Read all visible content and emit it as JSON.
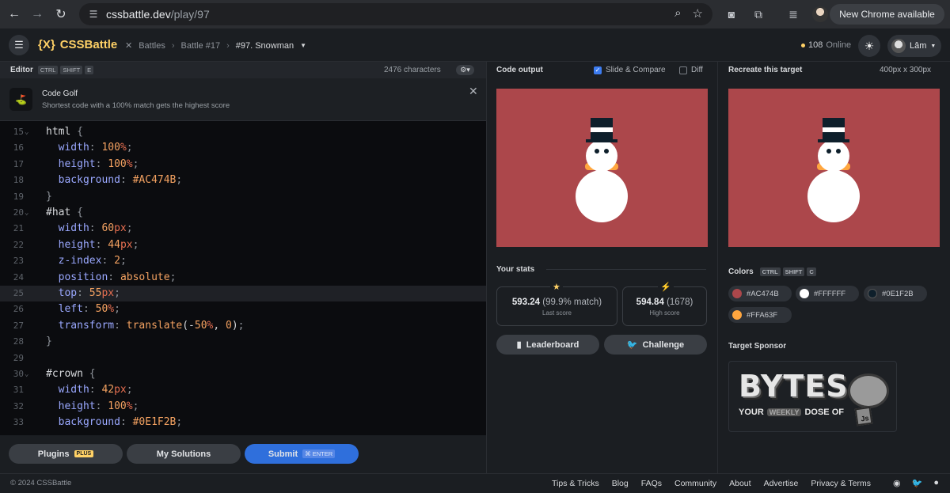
{
  "browser": {
    "url_host": "cssbattle.dev",
    "url_path": "/play/97",
    "new_chrome_label": "New Chrome available"
  },
  "header": {
    "logo": "{X}",
    "brand": "CSSBattle",
    "breadcrumbs": [
      "Battles",
      "Battle #17",
      "#97. Snowman"
    ],
    "online_count": "108",
    "online_label": "Online",
    "user_name": "Lâm"
  },
  "editor": {
    "label": "Editor",
    "shortcut": [
      "CTRL",
      "SHIFT",
      "E"
    ],
    "char_count": "2476 characters",
    "golf_title": "Code Golf",
    "golf_subtitle": "Shortest code with a 100% match gets the highest score",
    "lines": [
      {
        "n": "15",
        "fold": true,
        "code": "html {"
      },
      {
        "n": "16",
        "code": "  width: 100%;"
      },
      {
        "n": "17",
        "code": "  height: 100%;"
      },
      {
        "n": "18",
        "code": "  background: #AC474B;"
      },
      {
        "n": "19",
        "code": "}"
      },
      {
        "n": "20",
        "fold": true,
        "code": "#hat {"
      },
      {
        "n": "21",
        "code": "  width: 60px;"
      },
      {
        "n": "22",
        "code": "  height: 44px;"
      },
      {
        "n": "23",
        "code": "  z-index: 2;"
      },
      {
        "n": "24",
        "code": "  position: absolute;"
      },
      {
        "n": "25",
        "code": "  top: 55px;",
        "active": true
      },
      {
        "n": "26",
        "code": "  left: 50%;"
      },
      {
        "n": "27",
        "code": "  transform: translate(-50%, 0);"
      },
      {
        "n": "28",
        "code": "}"
      },
      {
        "n": "29",
        "code": ""
      },
      {
        "n": "30",
        "fold": true,
        "code": "#crown {"
      },
      {
        "n": "31",
        "code": "  width: 42px;"
      },
      {
        "n": "32",
        "code": "  height: 100%;"
      },
      {
        "n": "33",
        "code": "  background: #0E1F2B;"
      }
    ],
    "plugins_label": "Plugins",
    "plugins_badge": "PLUS",
    "solutions_label": "My Solutions",
    "submit_label": "Submit",
    "submit_shortcut": "⌘ ENTER"
  },
  "output": {
    "title": "Code output",
    "slide_compare": "Slide & Compare",
    "slide_compare_checked": true,
    "diff": "Diff",
    "diff_checked": false
  },
  "stats": {
    "title": "Your stats",
    "last_score": "593.24",
    "last_match": "(99.9% match)",
    "last_label": "Last score",
    "high_score": "594.84",
    "high_rank": "(1678)",
    "high_label": "High score",
    "leaderboard_label": "Leaderboard",
    "challenge_label": "Challenge"
  },
  "target": {
    "title": "Recreate this target",
    "size": "400px x 300px",
    "colors_title": "Colors",
    "colors_shortcut": [
      "CTRL",
      "SHIFT",
      "C"
    ],
    "colors": [
      "#AC474B",
      "#FFFFFF",
      "#0E1F2B",
      "#FFA63F"
    ],
    "sponsor_title": "Target Sponsor",
    "sponsor_name": "BYTES",
    "sponsor_tag_1": "YOUR",
    "sponsor_tag_2": "WEEKLY",
    "sponsor_tag_3": "DOSE OF",
    "sponsor_tag_4": "Js"
  },
  "footer": {
    "copyright": "© 2024 CSSBattle",
    "links": [
      "Tips & Tricks",
      "Blog",
      "FAQs",
      "Community",
      "About",
      "Advertise",
      "Privacy & Terms"
    ]
  },
  "palette": {
    "bg": "#AC474B",
    "white": "#FFFFFF",
    "navy": "#0E1F2B",
    "orange": "#FFA63F",
    "accent": "#2F6FDC"
  }
}
